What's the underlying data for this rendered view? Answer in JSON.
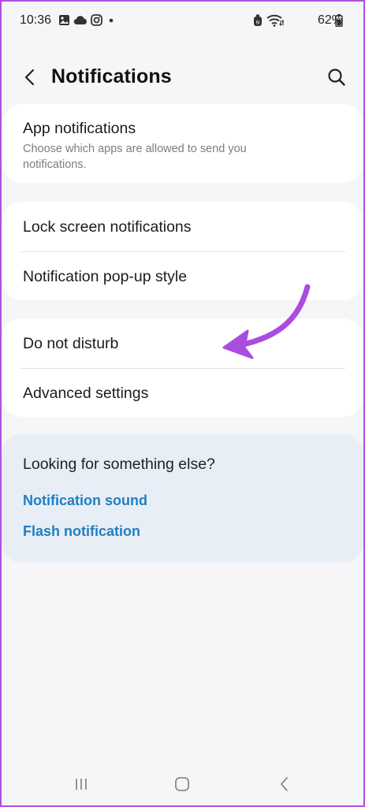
{
  "status_bar": {
    "time": "10:36",
    "battery_percent": "62%",
    "left_icons": [
      "image-icon",
      "cloud-icon",
      "instagram-icon",
      "dot-icon"
    ],
    "right_icons": [
      "nfc-icon",
      "wifi-icon",
      "battery-icon"
    ]
  },
  "header": {
    "title": "Notifications",
    "back_icon": "back-arrow-icon",
    "search_icon": "search-icon"
  },
  "card_app": {
    "title": "App notifications",
    "subtitle": "Choose which apps are allowed to send you notifications."
  },
  "card_lock": {
    "items": [
      {
        "label": "Lock screen notifications"
      },
      {
        "label": "Notification pop-up style"
      }
    ]
  },
  "card_dnd": {
    "items": [
      {
        "label": "Do not disturb"
      },
      {
        "label": "Advanced settings"
      }
    ]
  },
  "suggestions": {
    "title": "Looking for something else?",
    "links": [
      {
        "label": "Notification sound"
      },
      {
        "label": "Flash notification"
      }
    ]
  },
  "annotation": {
    "color": "#a84de0"
  },
  "colors": {
    "frame": "#b24fe0",
    "background": "#f6f5f8",
    "card": "#ffffff",
    "suggest_bg": "#e8eef6",
    "link": "#1f7fc1"
  }
}
